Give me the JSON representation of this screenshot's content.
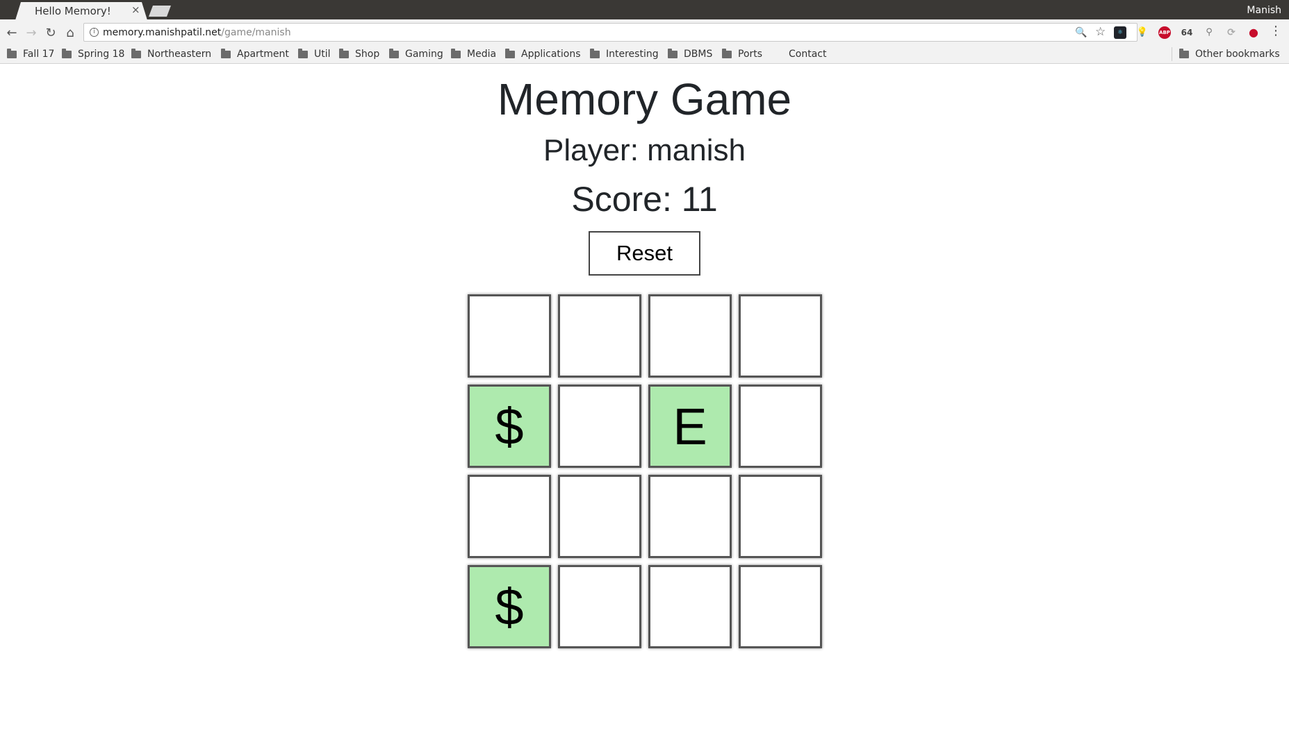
{
  "browser": {
    "tab_title": "Hello Memory!",
    "tab_close": "×",
    "profile_name": "Manish",
    "url_host": "memory.manishpatil.net",
    "url_path": "/game/manish",
    "nav": {
      "back": "←",
      "forward": "→",
      "reload": "↻",
      "home": "⌂"
    },
    "omnibox_icons": {
      "zoom": "🔍",
      "star": "☆"
    },
    "extensions": [
      {
        "icon": "react-devtools-icon",
        "label": "⚛",
        "color": "#20232a"
      },
      {
        "icon": "lightbulb-icon",
        "label": "💡",
        "color": "#f2f2f2"
      },
      {
        "icon": "adblock-plus-icon",
        "label": "ABP",
        "color": "#c70d2c"
      },
      {
        "icon": "c64-icon",
        "label": "64",
        "color": "#f2f2f2"
      },
      {
        "icon": "cycling-icon",
        "label": "⚲",
        "color": "#f2f2f2"
      },
      {
        "icon": "sync-icon",
        "label": "⟳",
        "color": "#f2f2f2"
      },
      {
        "icon": "record-icon",
        "label": "●",
        "color": "#c70d2c"
      }
    ],
    "menu": "⋮",
    "bookmarks": [
      "Fall 17",
      "Spring 18",
      "Northeastern",
      "Apartment",
      "Util",
      "Shop",
      "Gaming",
      "Media",
      "Applications",
      "Interesting",
      "DBMS",
      "Ports"
    ],
    "bookmark_contact": "Contact",
    "other_bookmarks": "Other bookmarks"
  },
  "game": {
    "title": "Memory Game",
    "player": "Player: manish",
    "score": "Score: 11",
    "reset_label": "Reset",
    "revealed_color": "#aeeaae",
    "tiles": [
      "",
      "",
      "",
      "",
      "$",
      "",
      "E",
      "",
      "",
      "",
      "",
      "",
      "$",
      "",
      "",
      ""
    ]
  }
}
